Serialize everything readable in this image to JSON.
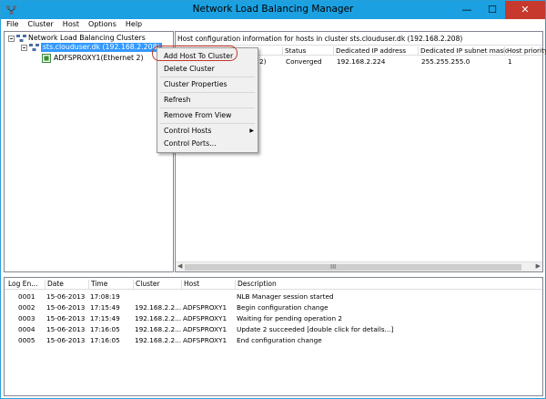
{
  "window": {
    "title": "Network Load Balancing Manager",
    "minimize": "—",
    "maximize": "☐",
    "close": "✕"
  },
  "menu": [
    "File",
    "Cluster",
    "Host",
    "Options",
    "Help"
  ],
  "tree": {
    "root_label": "Network Load Balancing Clusters",
    "cluster_label": "sts.clouduser.dk (192.168.2.208)",
    "host_label": "ADFSPROXY1(Ethernet 2)"
  },
  "host_pane": {
    "info": "Host configuration information for hosts in cluster sts.clouduser.dk (192.168.2.208)",
    "columns": [
      "Status",
      "Dedicated IP address",
      "Dedicated IP subnet mask",
      "Host priority"
    ],
    "row": {
      "partial": "2)",
      "status": "Converged",
      "ip": "192.168.2.224",
      "mask": "255.255.255.0",
      "priority": "1"
    },
    "scroll_grip": "III"
  },
  "context_menu": {
    "items": [
      "Add Host To Cluster",
      "Delete Cluster",
      "Cluster Properties",
      "Refresh",
      "Remove From View",
      "Control Hosts",
      "Control Ports..."
    ],
    "submenu_arrow": "▶"
  },
  "log": {
    "columns": [
      "Log En...",
      "Date",
      "Time",
      "Cluster",
      "Host",
      "Description"
    ],
    "rows": [
      {
        "id": "0001",
        "date": "15-06-2013",
        "time": "17:08:19",
        "cluster": "",
        "host": "",
        "desc": "NLB Manager session started"
      },
      {
        "id": "0002",
        "date": "15-06-2013",
        "time": "17:15:49",
        "cluster": "192.168.2.2...",
        "host": "ADFSPROXY1",
        "desc": "Begin configuration change"
      },
      {
        "id": "0003",
        "date": "15-06-2013",
        "time": "17:15:49",
        "cluster": "192.168.2.2...",
        "host": "ADFSPROXY1",
        "desc": "Waiting for pending operation 2"
      },
      {
        "id": "0004",
        "date": "15-06-2013",
        "time": "17:16:05",
        "cluster": "192.168.2.2...",
        "host": "ADFSPROXY1",
        "desc": "Update 2 succeeded [double click for details...]"
      },
      {
        "id": "0005",
        "date": "15-06-2013",
        "time": "17:16:05",
        "cluster": "192.168.2.2...",
        "host": "ADFSPROXY1",
        "desc": "End configuration change"
      }
    ]
  },
  "colors": {
    "titlebar": "#1ba1e2",
    "selection": "#3399ff",
    "highlight_ring": "#c0392b",
    "close": "#c7392c"
  }
}
